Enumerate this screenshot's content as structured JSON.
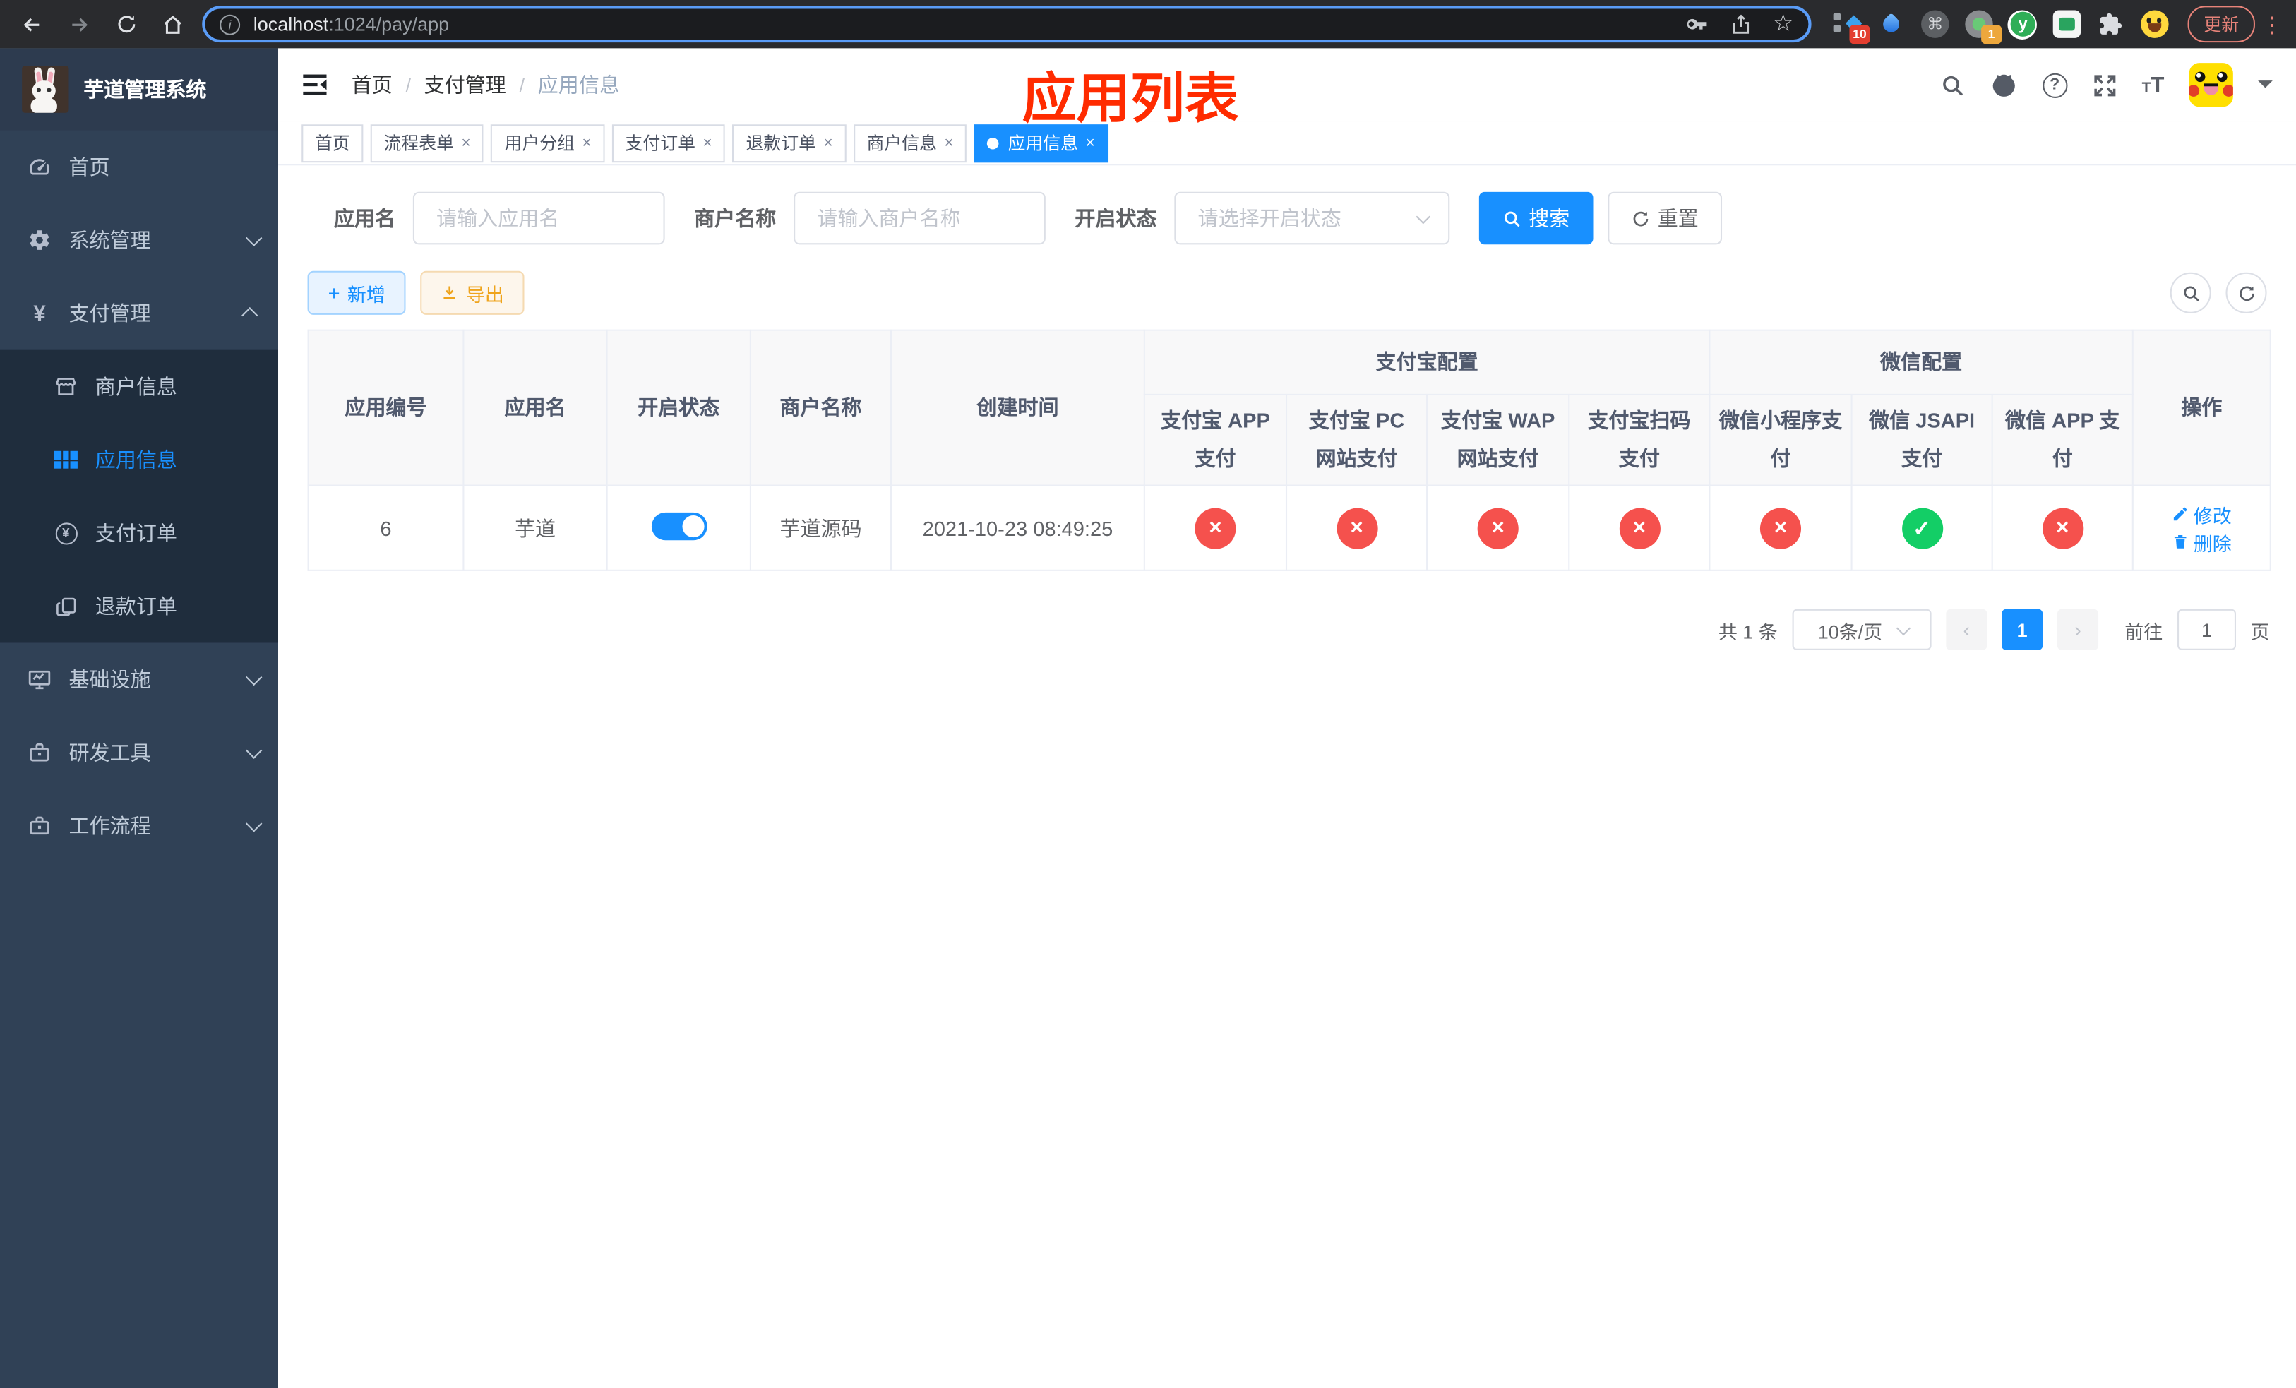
{
  "browser": {
    "url_host": "localhost",
    "url_path": ":1024/pay/app",
    "update_button": "更新",
    "extension_badge_1": "10",
    "extension_badge_4": "1",
    "extension_y_label": "y"
  },
  "sidebar": {
    "title": "芋道管理系统",
    "items": [
      {
        "label": "首页",
        "icon": "dashboard-icon"
      },
      {
        "label": "系统管理",
        "icon": "gear-icon"
      },
      {
        "label": "支付管理",
        "icon": "yen-icon",
        "children": [
          {
            "label": "商户信息",
            "icon": "shop-icon"
          },
          {
            "label": "应用信息",
            "icon": "grid-icon",
            "active": true
          },
          {
            "label": "支付订单",
            "icon": "yen-circle-icon"
          },
          {
            "label": "退款订单",
            "icon": "document-icon"
          }
        ]
      },
      {
        "label": "基础设施",
        "icon": "monitor-icon"
      },
      {
        "label": "研发工具",
        "icon": "toolbox-icon"
      },
      {
        "label": "工作流程",
        "icon": "toolbox-icon"
      }
    ]
  },
  "navbar": {
    "breadcrumb": [
      "首页",
      "支付管理",
      "应用信息"
    ],
    "separator": "/",
    "annotation": "应用列表"
  },
  "tabs": {
    "close_glyph": "×",
    "items": [
      {
        "label": "首页"
      },
      {
        "label": "流程表单"
      },
      {
        "label": "用户分组"
      },
      {
        "label": "支付订单"
      },
      {
        "label": "退款订单"
      },
      {
        "label": "商户信息"
      },
      {
        "label": "应用信息"
      }
    ]
  },
  "filter": {
    "app_name_label": "应用名",
    "app_name_placeholder": "请输入应用名",
    "merchant_label": "商户名称",
    "merchant_placeholder": "请输入商户名称",
    "status_label": "开启状态",
    "status_placeholder": "请选择开启状态",
    "search_label": "搜索",
    "reset_label": "重置"
  },
  "toolbar": {
    "add_label": "新增",
    "export_label": "导出"
  },
  "table": {
    "group_headers": {
      "alipay": "支付宝配置",
      "wechat": "微信配置"
    },
    "columns": [
      "应用编号",
      "应用名",
      "开启状态",
      "商户名称",
      "创建时间",
      "支付宝 APP 支付",
      "支付宝 PC 网站支付",
      "支付宝 WAP 网站支付",
      "支付宝扫码支付",
      "微信小程序支付",
      "微信 JSAPI 支付",
      "微信 APP 支付",
      "操作"
    ],
    "row": {
      "app_id": "6",
      "app_name": "芋道",
      "status_on": true,
      "merchant_name": "芋道源码",
      "create_time": "2021-10-23 08:49:25",
      "pay_status": [
        "x",
        "x",
        "x",
        "x",
        "x",
        "check",
        "x"
      ],
      "edit_label": "修改",
      "delete_label": "删除"
    }
  },
  "pagination": {
    "total_text": "共 1 条",
    "page_size": "10条/页",
    "current_page": "1",
    "goto_label": "前往",
    "goto_value": "1",
    "page_unit": "页"
  },
  "colors": {
    "primary": "#1890ff",
    "success": "#13ce66",
    "danger": "#f5514d",
    "warning": "#efa41c",
    "annotation": "#ff2b00",
    "sidebar_bg": "#304156",
    "submenu_bg": "#1f2d3d",
    "update_button": "#e88379"
  }
}
